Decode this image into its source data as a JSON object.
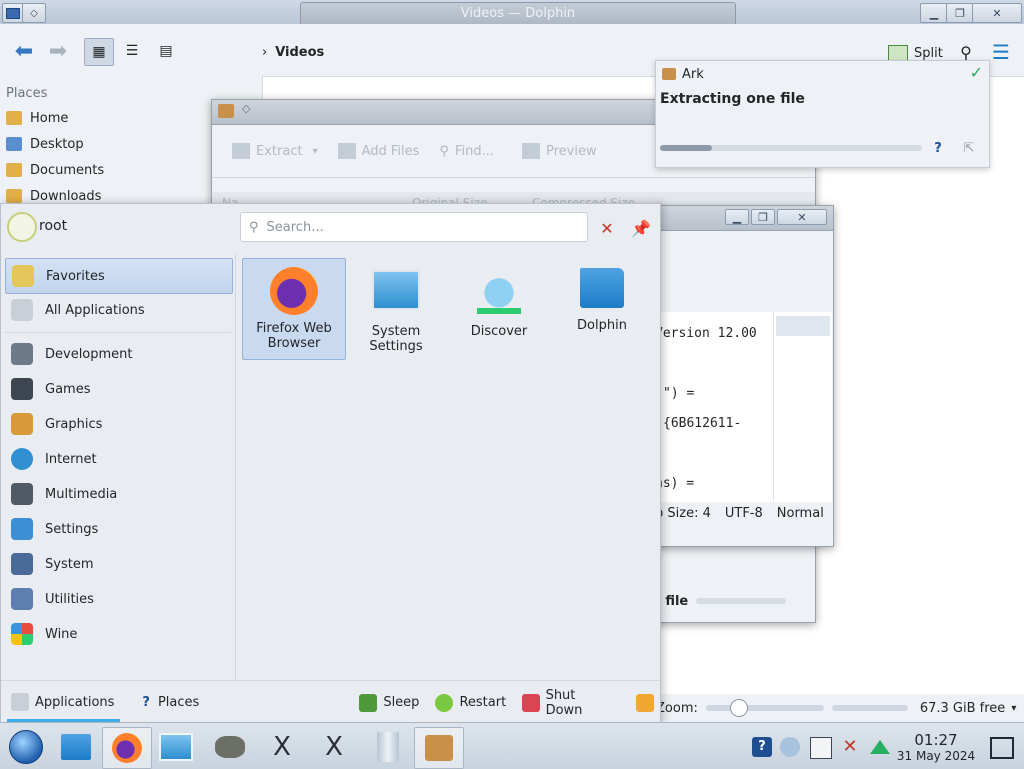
{
  "dolphin": {
    "window_title": "Videos — Dolphin",
    "breadcrumb": "Videos",
    "split_label": "Split",
    "places_header": "Places",
    "places": [
      "Home",
      "Desktop",
      "Documents",
      "Downloads"
    ],
    "zoom_label": "Zoom:",
    "free_space": "67.3 GiB free"
  },
  "ark_dialog": {
    "toolbar": {
      "extract": "Extract",
      "add_files": "Add Files",
      "find": "Find...",
      "preview": "Preview"
    },
    "columns": [
      "Na",
      "Original Size",
      "Compressed Size"
    ],
    "status_fragment": "e file"
  },
  "editor_window": {
    "lines": [
      "Version 12.00",
      "\") =",
      "{6B612611-",
      "ns) ="
    ],
    "status": {
      "tab": "b Size: 4",
      "encoding": "UTF-8",
      "mode": "Normal"
    }
  },
  "ark_notification": {
    "app": "Ark",
    "title": "Extracting one file",
    "progress": 0.2
  },
  "launcher": {
    "user": "root",
    "search_placeholder": "Search...",
    "categories": [
      "Favorites",
      "All Applications",
      "Development",
      "Games",
      "Graphics",
      "Internet",
      "Multimedia",
      "Settings",
      "System",
      "Utilities",
      "Wine"
    ],
    "favorites": [
      {
        "label": "Firefox Web Browser"
      },
      {
        "label": "System Settings"
      },
      {
        "label": "Discover"
      },
      {
        "label": "Dolphin"
      }
    ],
    "footer": {
      "applications": "Applications",
      "places": "Places",
      "sleep": "Sleep",
      "restart": "Restart",
      "shutdown": "Shut Down"
    }
  },
  "clock": {
    "time": "01:27",
    "date": "31 May 2024"
  },
  "colors": {
    "accent": "#3daee9",
    "selection": "#c9d9ef",
    "dolphin_folder": "#1d7cc7"
  }
}
